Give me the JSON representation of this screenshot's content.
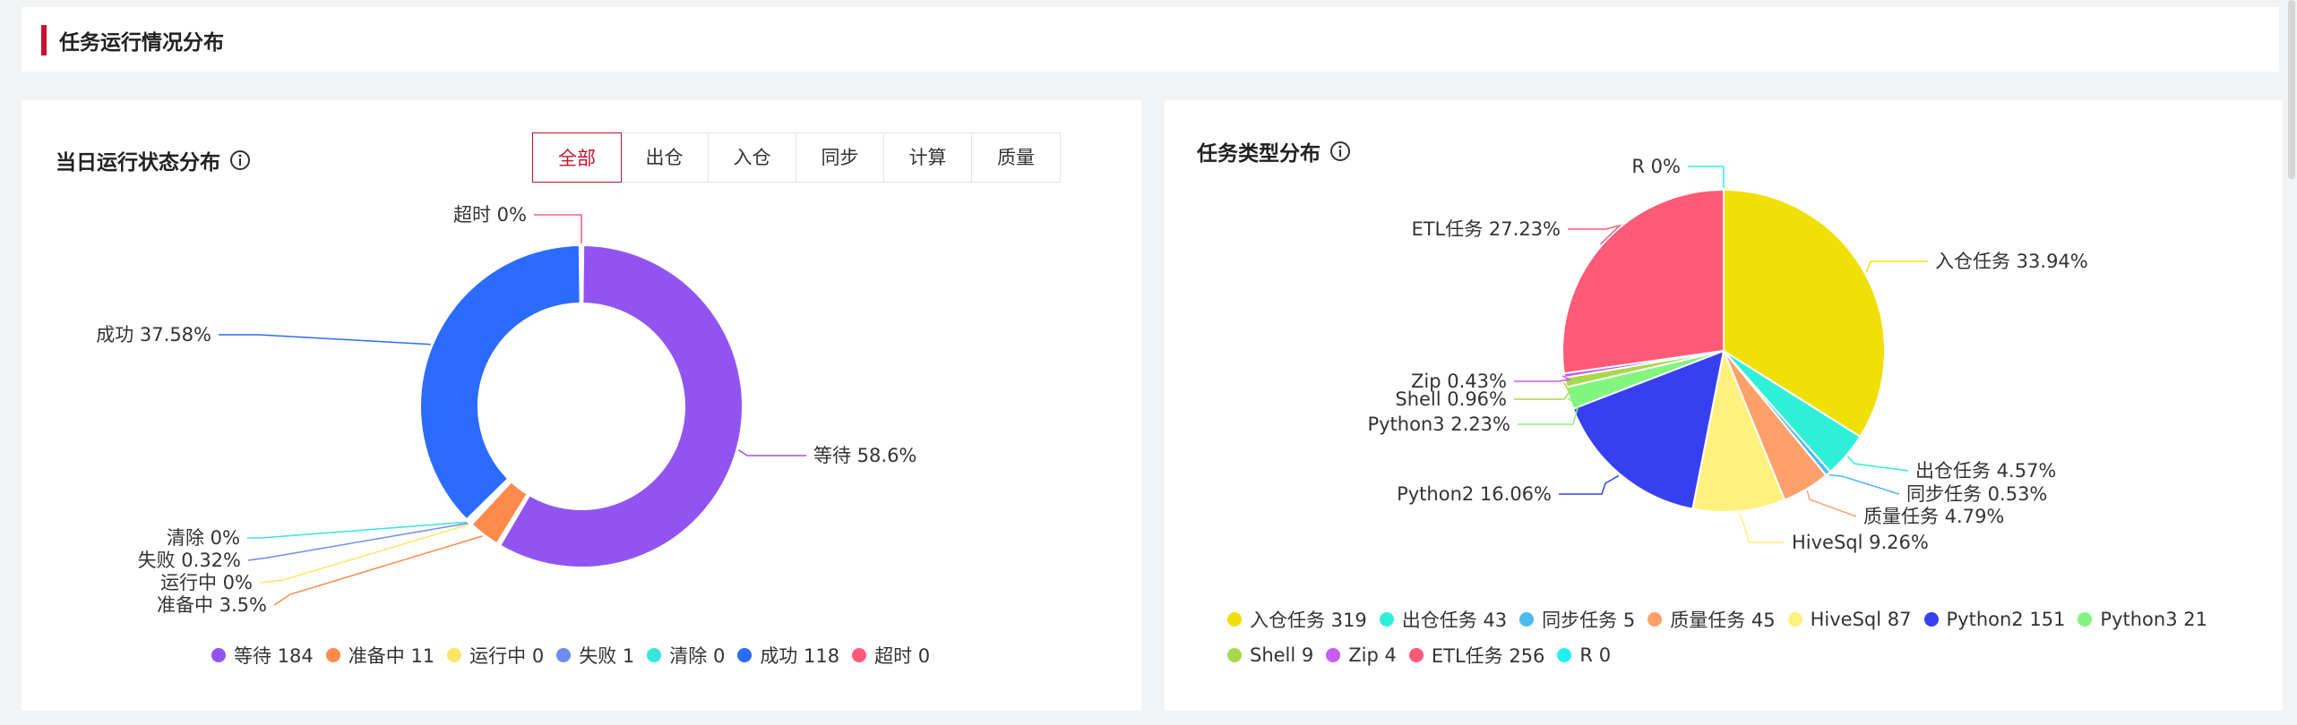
{
  "page": {
    "section_title": "任务运行情况分布"
  },
  "left": {
    "title": "当日运行状态分布",
    "tabs": [
      "全部",
      "出仓",
      "入仓",
      "同步",
      "计算",
      "质量"
    ],
    "active_tab": "全部"
  },
  "right": {
    "title": "任务类型分布"
  },
  "chart_data": [
    {
      "type": "pie",
      "variant": "donut",
      "title": "当日运行状态分布",
      "categories": [
        "等待",
        "准备中",
        "运行中",
        "失败",
        "清除",
        "成功",
        "超时"
      ],
      "values": [
        184,
        11,
        0,
        1,
        0,
        118,
        0
      ],
      "percent_labels": [
        "等待 58.6%",
        "准备中 3.5%",
        "运行中 0%",
        "失败 0.32%",
        "清除 0%",
        "成功 37.58%",
        "超时 0%"
      ],
      "legend_labels": [
        "等待 184",
        "准备中 11",
        "运行中 0",
        "失败 1",
        "清除 0",
        "成功 118",
        "超时 0"
      ],
      "colors": [
        "#9254f0",
        "#ff8a4c",
        "#ffe566",
        "#6e8cf0",
        "#36e6d9",
        "#2b6bff",
        "#ff5a7a"
      ],
      "legend_position": "bottom"
    },
    {
      "type": "pie",
      "title": "任务类型分布",
      "categories": [
        "入仓任务",
        "出仓任务",
        "同步任务",
        "质量任务",
        "HiveSql",
        "Python2",
        "Python3",
        "Shell",
        "Zip",
        "ETL任务",
        "R"
      ],
      "values": [
        319,
        43,
        5,
        45,
        87,
        151,
        21,
        9,
        4,
        256,
        0
      ],
      "percent_labels": [
        "入仓任务 33.94%",
        "出仓任务 4.57%",
        "同步任务 0.53%",
        "质量任务 4.79%",
        "HiveSql 9.26%",
        "Python2 16.06%",
        "Python3 2.23%",
        "Shell 0.96%",
        "Zip 0.43%",
        "ETL任务 27.23%",
        "R 0%"
      ],
      "legend_labels": [
        "入仓任务 319",
        "出仓任务 43",
        "同步任务 5",
        "质量任务 45",
        "HiveSql 87",
        "Python2 151",
        "Python3 21",
        "Shell 9",
        "Zip 4",
        "ETL任务 256",
        "R 0"
      ],
      "colors": [
        "#f0e008",
        "#30efd9",
        "#4db9f5",
        "#ffa06a",
        "#fff17e",
        "#3640f0",
        "#82f57e",
        "#a8d94a",
        "#c85cf0",
        "#ff5a78",
        "#22f0f0"
      ],
      "legend_position": "bottom"
    }
  ]
}
